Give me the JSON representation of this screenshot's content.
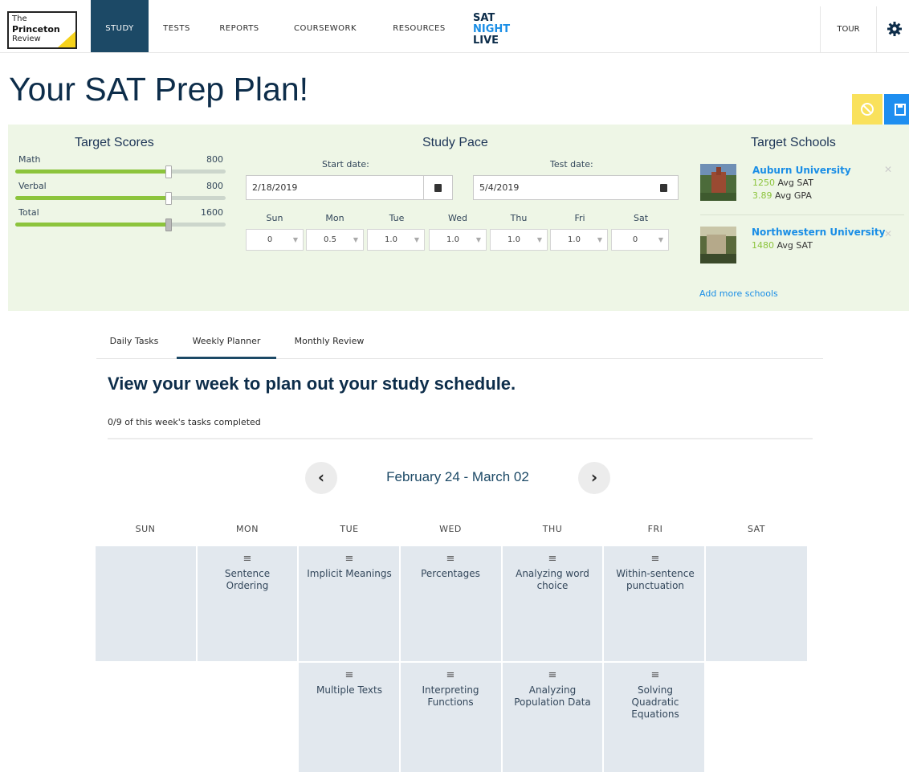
{
  "logo": {
    "line1": "The",
    "line2": "Princeton",
    "line3": "Review"
  },
  "nav": {
    "study": "STUDY",
    "tests": "TESTS",
    "reports": "REPORTS",
    "coursework": "COURSEWORK",
    "resources": "RESOURCES",
    "snl": {
      "l1": "SAT",
      "l2": "NIGHT",
      "l3": "LIVE"
    },
    "tour": "TOUR"
  },
  "page_title": "Your SAT Prep Plan!",
  "target_scores": {
    "title": "Target Scores",
    "items": [
      {
        "label": "Math",
        "value": "800",
        "fraction": 0.73
      },
      {
        "label": "Verbal",
        "value": "800",
        "fraction": 0.73
      },
      {
        "label": "Total",
        "value": "1600",
        "fraction": 0.73
      }
    ]
  },
  "study_pace": {
    "title": "Study Pace",
    "start_label": "Start date:",
    "start_value": "2/18/2019",
    "test_label": "Test date:",
    "test_value": "5/4/2019",
    "days": [
      "Sun",
      "Mon",
      "Tue",
      "Wed",
      "Thu",
      "Fri",
      "Sat"
    ],
    "hours": [
      "0",
      "0.5",
      "1.0",
      "1.0",
      "1.0",
      "1.0",
      "0"
    ]
  },
  "target_schools": {
    "title": "Target Schools",
    "schools": [
      {
        "name": "Auburn University",
        "sat": "1250",
        "sat_label": "Avg SAT",
        "gpa": "3.89",
        "gpa_label": "Avg GPA"
      },
      {
        "name": "Northwestern University",
        "sat": "1480",
        "sat_label": "Avg SAT"
      }
    ],
    "add_link": "Add more schools"
  },
  "tabs": [
    "Daily Tasks",
    "Weekly Planner",
    "Monthly Review"
  ],
  "heading": "View your week to plan out your study schedule.",
  "progress_text": "0/9 of this week's tasks completed",
  "week_range": "February 24 - March 02",
  "week_days": [
    "SUN",
    "MON",
    "TUE",
    "WED",
    "THU",
    "FRI",
    "SAT"
  ],
  "tasks_row1": {
    "mon": "Sentence Ordering",
    "tue": "Implicit Meanings",
    "wed": "Percentages",
    "thu": "Analyzing word choice",
    "fri": "Within-sentence punctuation"
  },
  "tasks_row2": {
    "tue": "Multiple Texts",
    "wed": "Interpreting Functions",
    "thu": "Analyzing Population Data",
    "fri": "Solving Quadratic Equations"
  },
  "colors": {
    "brand": "#1c4966",
    "accent_green": "#8cc43c",
    "link_blue": "#1a8ee6"
  },
  "icons": [
    "gear-icon",
    "cancel-icon",
    "save-icon",
    "calendar-icon",
    "chevron-left-icon",
    "chevron-right-icon",
    "handle-icon",
    "close-icon"
  ]
}
